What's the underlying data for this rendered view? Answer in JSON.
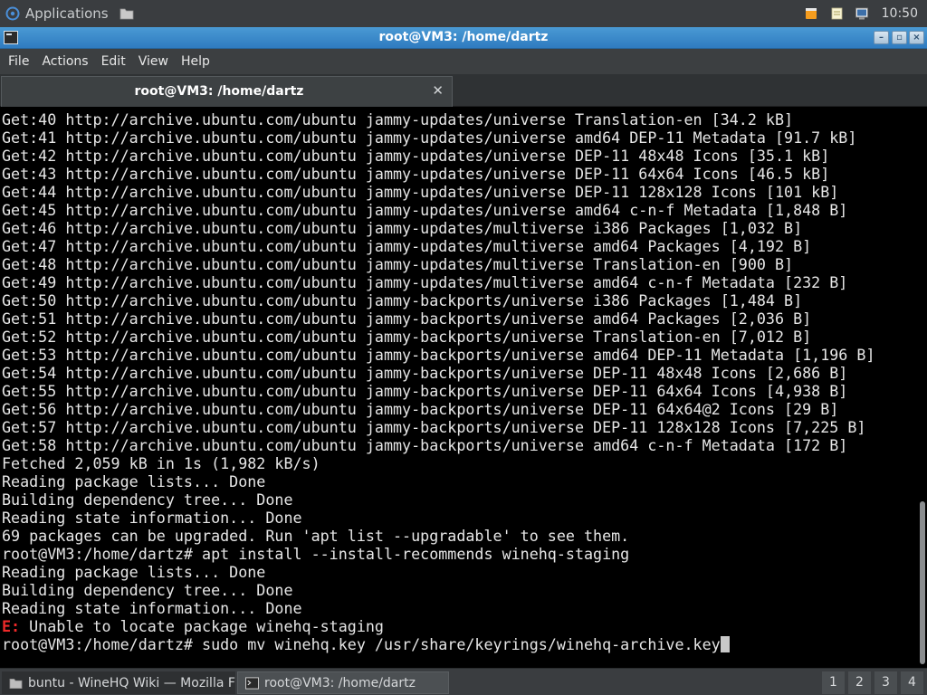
{
  "top_panel": {
    "applications_label": "Applications",
    "clock": "10:50",
    "icons": [
      "xubuntu-logo-icon",
      "file-manager-icon",
      "updates-icon",
      "notes-icon",
      "network-icon"
    ]
  },
  "window": {
    "title": "root@VM3: /home/dartz",
    "controls": [
      "minimize",
      "maximize",
      "close"
    ]
  },
  "menubar": {
    "items": [
      "File",
      "Actions",
      "Edit",
      "View",
      "Help"
    ]
  },
  "tab": {
    "label": "root@VM3: /home/dartz",
    "close_glyph": "✕"
  },
  "terminal": {
    "lines": [
      {
        "text": "Get:40 http://archive.ubuntu.com/ubuntu jammy-updates/universe Translation-en [34.2 kB]"
      },
      {
        "text": "Get:41 http://archive.ubuntu.com/ubuntu jammy-updates/universe amd64 DEP-11 Metadata [91.7 kB]"
      },
      {
        "text": "Get:42 http://archive.ubuntu.com/ubuntu jammy-updates/universe DEP-11 48x48 Icons [35.1 kB]"
      },
      {
        "text": "Get:43 http://archive.ubuntu.com/ubuntu jammy-updates/universe DEP-11 64x64 Icons [46.5 kB]"
      },
      {
        "text": "Get:44 http://archive.ubuntu.com/ubuntu jammy-updates/universe DEP-11 128x128 Icons [101 kB]"
      },
      {
        "text": "Get:45 http://archive.ubuntu.com/ubuntu jammy-updates/universe amd64 c-n-f Metadata [1,848 B]"
      },
      {
        "text": "Get:46 http://archive.ubuntu.com/ubuntu jammy-updates/multiverse i386 Packages [1,032 B]"
      },
      {
        "text": "Get:47 http://archive.ubuntu.com/ubuntu jammy-updates/multiverse amd64 Packages [4,192 B]"
      },
      {
        "text": "Get:48 http://archive.ubuntu.com/ubuntu jammy-updates/multiverse Translation-en [900 B]"
      },
      {
        "text": "Get:49 http://archive.ubuntu.com/ubuntu jammy-updates/multiverse amd64 c-n-f Metadata [232 B]"
      },
      {
        "text": "Get:50 http://archive.ubuntu.com/ubuntu jammy-backports/universe i386 Packages [1,484 B]"
      },
      {
        "text": "Get:51 http://archive.ubuntu.com/ubuntu jammy-backports/universe amd64 Packages [2,036 B]"
      },
      {
        "text": "Get:52 http://archive.ubuntu.com/ubuntu jammy-backports/universe Translation-en [7,012 B]"
      },
      {
        "text": "Get:53 http://archive.ubuntu.com/ubuntu jammy-backports/universe amd64 DEP-11 Metadata [1,196 B]"
      },
      {
        "text": "Get:54 http://archive.ubuntu.com/ubuntu jammy-backports/universe DEP-11 48x48 Icons [2,686 B]"
      },
      {
        "text": "Get:55 http://archive.ubuntu.com/ubuntu jammy-backports/universe DEP-11 64x64 Icons [4,938 B]"
      },
      {
        "text": "Get:56 http://archive.ubuntu.com/ubuntu jammy-backports/universe DEP-11 64x64@2 Icons [29 B]"
      },
      {
        "text": "Get:57 http://archive.ubuntu.com/ubuntu jammy-backports/universe DEP-11 128x128 Icons [7,225 B]"
      },
      {
        "text": "Get:58 http://archive.ubuntu.com/ubuntu jammy-backports/universe amd64 c-n-f Metadata [172 B]"
      },
      {
        "text": "Fetched 2,059 kB in 1s (1,982 kB/s)"
      },
      {
        "text": "Reading package lists... Done"
      },
      {
        "text": "Building dependency tree... Done"
      },
      {
        "text": "Reading state information... Done"
      },
      {
        "text": "69 packages can be upgraded. Run 'apt list --upgradable' to see them."
      },
      {
        "text": "root@VM3:/home/dartz# apt install --install-recommends winehq-staging"
      },
      {
        "text": "Reading package lists... Done"
      },
      {
        "text": "Building dependency tree... Done"
      },
      {
        "text": "Reading state information... Done"
      },
      {
        "prefix": "E:",
        "text": " Unable to locate package winehq-staging",
        "prefix_color": "#ef2929"
      },
      {
        "text": "root@VM3:/home/dartz# sudo mv winehq.key /usr/share/keyrings/winehq-archive.key",
        "cursor": true
      }
    ]
  },
  "taskbar": {
    "tasks": [
      {
        "label": "buntu - WineHQ Wiki — Mozilla Fir",
        "icon": "folder-icon",
        "active": false
      },
      {
        "label": "root@VM3: /home/dartz",
        "icon": "terminal-icon",
        "active": true
      }
    ],
    "workspaces": [
      "1",
      "2",
      "3",
      "4"
    ]
  },
  "colors": {
    "titlebar": "#2f7bc0",
    "terminal_bg": "#000000",
    "terminal_fg": "#e6e6e6",
    "error": "#ef2929"
  }
}
